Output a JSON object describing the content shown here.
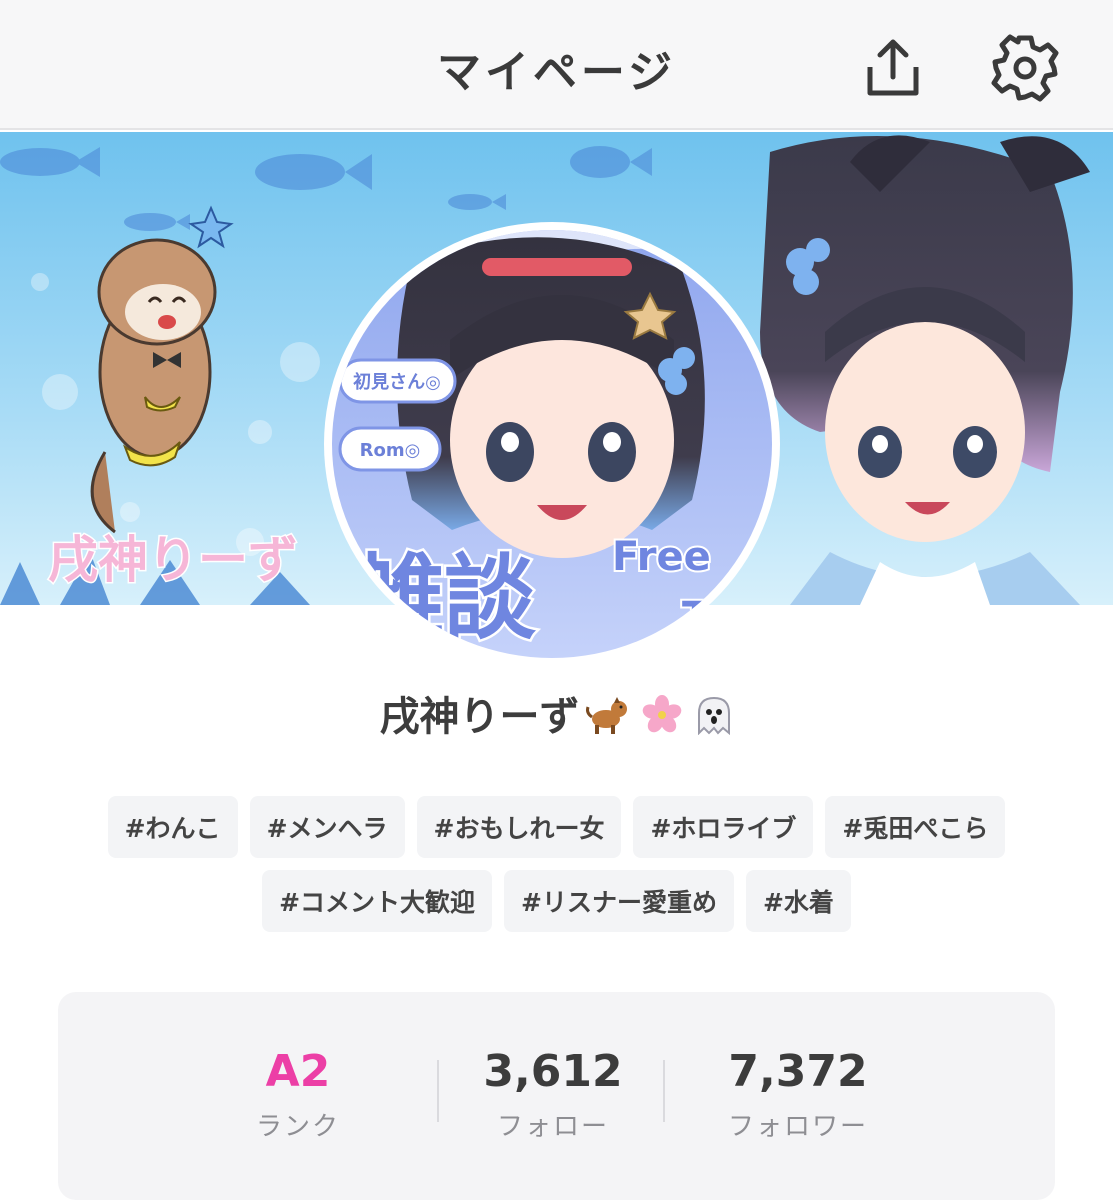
{
  "header": {
    "title": "マイページ",
    "share_icon": "share-upload-icon",
    "settings_icon": "gear-icon"
  },
  "banner": {
    "logo_text": "戌神りーず",
    "badge_first_time": "初見さん◎",
    "badge_rom": "Rom◎",
    "zatsudan_text": "雑談",
    "free_text": "Free",
    "talk_text": "To"
  },
  "profile": {
    "name": "戌神りーず",
    "emojis": [
      "dog-emoji",
      "cherry-blossom-emoji",
      "ghost-emoji"
    ]
  },
  "tags": [
    "#わんこ",
    "#メンヘラ",
    "#おもしれー女",
    "#ホロライブ",
    "#兎田ぺこら",
    "#コメント大歓迎",
    "#リスナー愛重め",
    "#水着"
  ],
  "stats": {
    "rank": {
      "value": "A2",
      "label": "ランク"
    },
    "follow": {
      "value": "3,612",
      "label": "フォロー"
    },
    "follower": {
      "value": "7,372",
      "label": "フォロワー"
    }
  },
  "colors": {
    "accent_rank": "#ec3fa6",
    "header_bg": "#f7f7f8",
    "tag_bg": "#f3f4f6",
    "stats_bg": "#f4f4f6",
    "banner_sky": "#7ec8ef"
  }
}
